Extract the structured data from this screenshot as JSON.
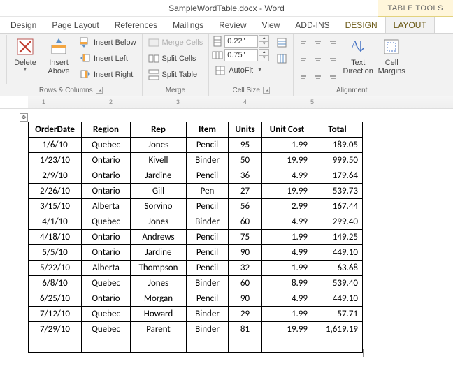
{
  "window": {
    "title": "SampleWordTable.docx - Word",
    "tools_label": "TABLE TOOLS"
  },
  "tabs": {
    "design": "Design",
    "page_layout": "Page Layout",
    "references": "References",
    "mailings": "Mailings",
    "review": "Review",
    "view": "View",
    "addins": "ADD-INS",
    "ctx_design": "DESIGN",
    "ctx_layout": "LAYOUT"
  },
  "ribbon": {
    "rows_cols": {
      "label": "Rows & Columns",
      "delete": "Delete",
      "insert_above": "Insert\nAbove",
      "insert_below": "Insert Below",
      "insert_left": "Insert Left",
      "insert_right": "Insert Right"
    },
    "merge": {
      "label": "Merge",
      "merge_cells": "Merge Cells",
      "split_cells": "Split Cells",
      "split_table": "Split Table"
    },
    "cell_size": {
      "label": "Cell Size",
      "height": "0.22\"",
      "width": "0.75\"",
      "autofit": "AutoFit"
    },
    "alignment": {
      "label": "Alignment",
      "text_direction": "Text\nDirection",
      "cell_margins": "Cell\nMargins"
    }
  },
  "ruler": {
    "ticks": [
      "1",
      "2",
      "3",
      "4",
      "5"
    ]
  },
  "table": {
    "headers": [
      "OrderDate",
      "Region",
      "Rep",
      "Item",
      "Units",
      "Unit Cost",
      "Total"
    ],
    "rows": [
      [
        "1/6/10",
        "Quebec",
        "Jones",
        "Pencil",
        "95",
        "1.99",
        "189.05"
      ],
      [
        "1/23/10",
        "Ontario",
        "Kivell",
        "Binder",
        "50",
        "19.99",
        "999.50"
      ],
      [
        "2/9/10",
        "Ontario",
        "Jardine",
        "Pencil",
        "36",
        "4.99",
        "179.64"
      ],
      [
        "2/26/10",
        "Ontario",
        "Gill",
        "Pen",
        "27",
        "19.99",
        "539.73"
      ],
      [
        "3/15/10",
        "Alberta",
        "Sorvino",
        "Pencil",
        "56",
        "2.99",
        "167.44"
      ],
      [
        "4/1/10",
        "Quebec",
        "Jones",
        "Binder",
        "60",
        "4.99",
        "299.40"
      ],
      [
        "4/18/10",
        "Ontario",
        "Andrews",
        "Pencil",
        "75",
        "1.99",
        "149.25"
      ],
      [
        "5/5/10",
        "Ontario",
        "Jardine",
        "Pencil",
        "90",
        "4.99",
        "449.10"
      ],
      [
        "5/22/10",
        "Alberta",
        "Thompson",
        "Pencil",
        "32",
        "1.99",
        "63.68"
      ],
      [
        "6/8/10",
        "Quebec",
        "Jones",
        "Binder",
        "60",
        "8.99",
        "539.40"
      ],
      [
        "6/25/10",
        "Ontario",
        "Morgan",
        "Pencil",
        "90",
        "4.99",
        "449.10"
      ],
      [
        "7/12/10",
        "Quebec",
        "Howard",
        "Binder",
        "29",
        "1.99",
        "57.71"
      ],
      [
        "7/29/10",
        "Quebec",
        "Parent",
        "Binder",
        "81",
        "19.99",
        "1,619.19"
      ]
    ]
  }
}
